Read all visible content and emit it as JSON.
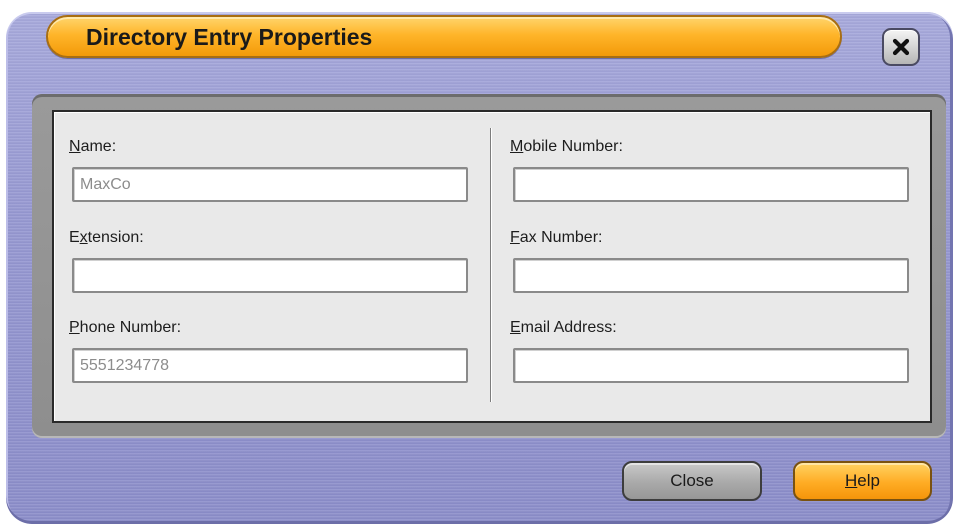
{
  "dialog": {
    "title": "Directory Entry Properties",
    "close_icon": "close-icon"
  },
  "fields": {
    "name": {
      "mnemonic": "N",
      "label_rest": "ame:",
      "value": "MaxCo"
    },
    "extension": {
      "label_pre": "E",
      "mnemonic": "x",
      "label_rest": "tension:",
      "value": ""
    },
    "phone": {
      "mnemonic": "P",
      "label_rest": "hone Number:",
      "value": "5551234778"
    },
    "mobile": {
      "mnemonic": "M",
      "label_rest": "obile Number:",
      "value": ""
    },
    "fax": {
      "mnemonic": "F",
      "label_rest": "ax Number:",
      "value": ""
    },
    "email": {
      "mnemonic": "E",
      "label_rest": "mail Address:",
      "value": ""
    }
  },
  "buttons": {
    "close_label": "Close",
    "help_mnemonic": "H",
    "help_rest": "elp"
  },
  "colors": {
    "title_bar": "#ffb52a",
    "window_frame": "#9698d2",
    "help_button": "#ffac24"
  }
}
